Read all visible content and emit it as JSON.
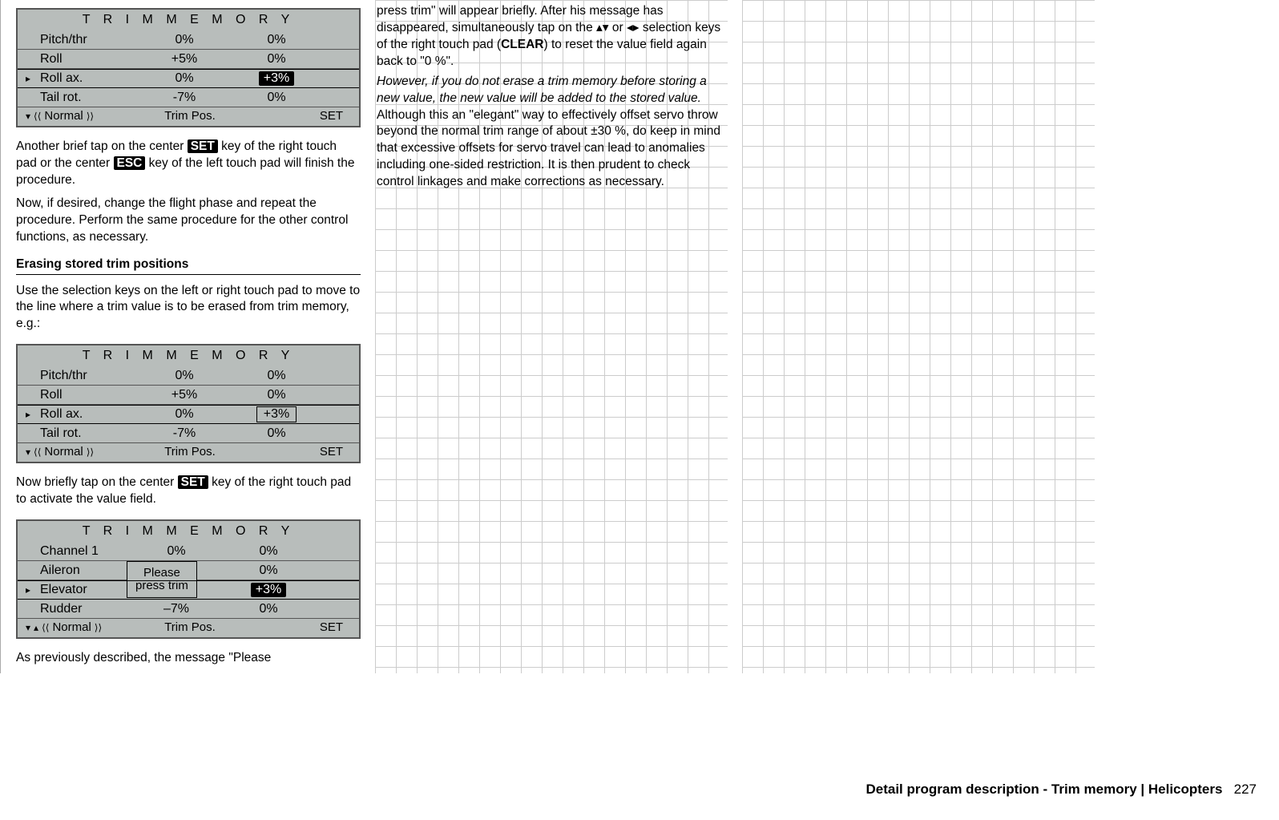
{
  "lcd_title": "T R I M   M E M O R Y",
  "table1": {
    "rows": [
      {
        "label": "Pitch/thr",
        "v1": "0%",
        "v2": "0%",
        "marker": ""
      },
      {
        "label": "Roll",
        "v1": "+5%",
        "v2": "0%",
        "marker": ""
      },
      {
        "label": "Roll ax.",
        "v1": "0%",
        "v2": "+3%",
        "marker": "▸",
        "v2style": "black"
      },
      {
        "label": "Tail rot.",
        "v1": "-7%",
        "v2": "0%",
        "marker": ""
      }
    ],
    "footer": {
      "mode": "Normal",
      "tp": "Trim Pos.",
      "set": "SET"
    }
  },
  "para1a": "Another brief tap on the center ",
  "key_set": "SET",
  "para1b": " key of the right touch pad or the center ",
  "key_esc": "ESC",
  "para1c": " key of the left touch pad will finish the procedure.",
  "para2": "Now, if desired, change the flight phase and repeat the procedure. Perform the same procedure for the other control functions, as necessary.",
  "subhead1": "Erasing stored trim positions",
  "para3": "Use the selection keys on the left or right touch pad to move to the line where a trim value is to be erased from trim memory, e.g.:",
  "table2": {
    "rows": [
      {
        "label": "Pitch/thr",
        "v1": "0%",
        "v2": "0%",
        "marker": ""
      },
      {
        "label": "Roll",
        "v1": "+5%",
        "v2": "0%",
        "marker": ""
      },
      {
        "label": "Roll ax.",
        "v1": "0%",
        "v2": "+3%",
        "marker": "▸",
        "v2style": "box"
      },
      {
        "label": "Tail rot.",
        "v1": "-7%",
        "v2": "0%",
        "marker": ""
      }
    ],
    "footer": {
      "mode": "Normal",
      "tp": "Trim Pos.",
      "set": "SET"
    }
  },
  "para4a": "Now briefly tap on the center ",
  "para4b": " key of the right touch pad to activate the value field.",
  "table3": {
    "rows": [
      {
        "label": "Channel 1",
        "v1": "0%",
        "v2": "0%"
      },
      {
        "label": "Aileron",
        "v1": "",
        "v2": "0%"
      },
      {
        "label": "Elevator",
        "v1": "",
        "v2": "+3%",
        "marker": "▸",
        "v2style": "black"
      },
      {
        "label": "Rudder",
        "v1": "–7%",
        "v2": "0%"
      }
    ],
    "msgbox_l1": "Please",
    "msgbox_l2": "press trim",
    "footer": {
      "mode": "Normal",
      "tp": "Trim Pos.",
      "set": "SET"
    }
  },
  "para5": "As previously described, the message \"Please",
  "col2_top": "press trim\" will appear briefly. After his message has disappeared, simultaneously tap on the ▴▾ or ◂▸ selection keys of the right touch pad (",
  "col2_clear": "CLEAR",
  "col2_top2": ") to reset the value field again back to \"0 %\".",
  "col2_ital": "However, if you do not erase a trim memory before storing a new value, the new value will be added to the stored value.",
  "col2_rest": " Although this an \"elegant\" way to effectively offset servo throw beyond the normal trim range of about ±30 %, do keep in mind that excessive offsets for servo travel can lead to anomalies including one-sided restriction. It is then prudent to check control linkages and make corrections as necessary.",
  "footer_title": "Detail program description - Trim memory | Helicopters",
  "page_num": "227"
}
